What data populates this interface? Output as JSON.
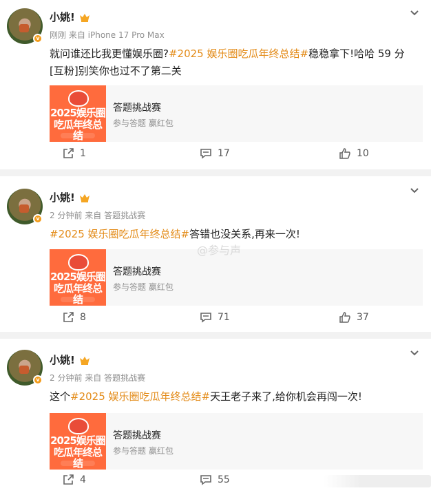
{
  "posts": [
    {
      "username": "小姚!",
      "time": "刚刚",
      "source": "来自 iPhone 17 Pro Max",
      "text_before": "就问谁还比我更懂娱乐圈?",
      "hashtag": "#2025 娱乐圈吃瓜年终总结#",
      "text_after": "稳稳拿下!哈哈 59 分[互粉]别笑你也过不了第二关",
      "card": {
        "title": "答题挑战赛",
        "subtitle": "参与答题 赢红包",
        "image_line1": "2025娱乐圈",
        "image_line2": "吃瓜年终总结"
      },
      "share_count": "1",
      "comment_count": "17",
      "like_count": "10"
    },
    {
      "username": "小姚!",
      "time": "2 分钟前",
      "source": "来自 答题挑战赛",
      "text_before": "",
      "hashtag": "#2025 娱乐圈吃瓜年终总结#",
      "text_after": "答错也没关系,再来一次!",
      "card": {
        "title": "答题挑战赛",
        "subtitle": "参与答题 赢红包",
        "image_line1": "2025娱乐圈",
        "image_line2": "吃瓜年终总结"
      },
      "share_count": "8",
      "comment_count": "71",
      "like_count": "37"
    },
    {
      "username": "小姚!",
      "time": "2 分钟前",
      "source": "来自 答题挑战赛",
      "text_before": "这个",
      "hashtag": "#2025 娱乐圈吃瓜年终总结#",
      "text_after": "天王老子来了,给你机会再闯一次!",
      "card": {
        "title": "答题挑战赛",
        "subtitle": "参与答题 赢红包",
        "image_line1": "2025娱乐圈",
        "image_line2": "吃瓜年终总结"
      },
      "share_count": "4",
      "comment_count": "55",
      "like_count": ""
    }
  ],
  "watermark": "@参与声",
  "colors": {
    "hashtag": "#e38b18",
    "verified": "#f39b1a",
    "crown": "#f5a623",
    "background": "#f2f2f2"
  }
}
